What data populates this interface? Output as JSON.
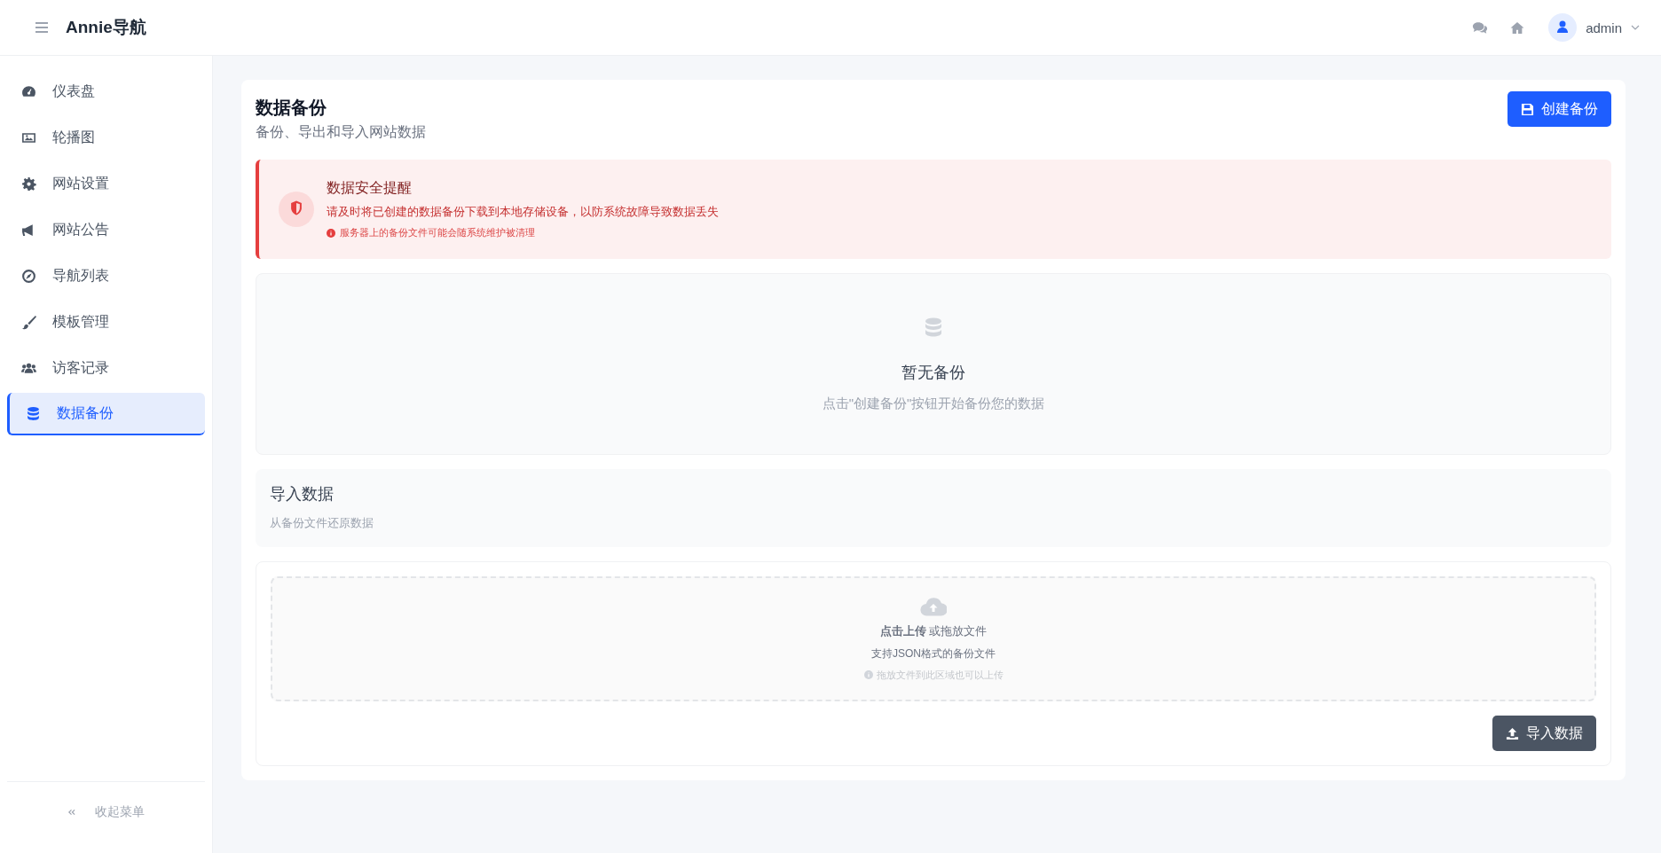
{
  "header": {
    "brand": "Annie导航",
    "user": "admin"
  },
  "sidebar": {
    "items": [
      {
        "label": "仪表盘",
        "selected": false
      },
      {
        "label": "轮播图",
        "selected": false
      },
      {
        "label": "网站设置",
        "selected": false
      },
      {
        "label": "网站公告",
        "selected": false
      },
      {
        "label": "导航列表",
        "selected": false
      },
      {
        "label": "模板管理",
        "selected": false
      },
      {
        "label": "访客记录",
        "selected": false
      },
      {
        "label": "数据备份",
        "selected": true
      }
    ],
    "collapse": "收起菜单"
  },
  "page": {
    "title": "数据备份",
    "subtitle": "备份、导出和导入网站数据",
    "create_button": "创建备份"
  },
  "alert": {
    "title": "数据安全提醒",
    "message": "请及时将已创建的数据备份下载到本地存储设备，以防系统故障导致数据丢失",
    "note": "服务器上的备份文件可能会随系统维护被清理"
  },
  "empty": {
    "title": "暂无备份",
    "hint": "点击\"创建备份\"按钮开始备份您的数据"
  },
  "import": {
    "title": "导入数据",
    "subtitle": "从备份文件还原数据",
    "upload_text": "**点击上传** 或拖放文件",
    "upload_hint": "支持JSON格式的备份文件",
    "upload_note": "拖放文件到此区域也可以上传",
    "button": "导入数据"
  }
}
